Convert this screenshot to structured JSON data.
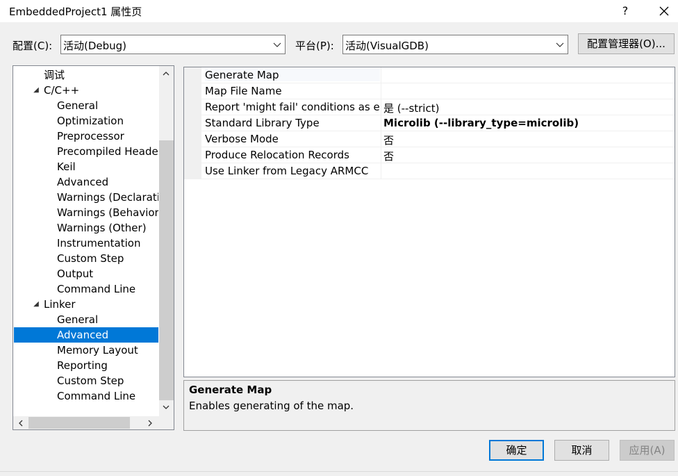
{
  "window": {
    "title": "EmbeddedProject1 属性页",
    "help": "?"
  },
  "config": {
    "label": "配置(C):",
    "value": "活动(Debug)",
    "platform_label": "平台(P):",
    "platform_value": "活动(VisualGDB)",
    "manager_button": "配置管理器(O)..."
  },
  "tree": {
    "items": [
      {
        "label": "调试",
        "level": 1
      },
      {
        "label": "C/C++",
        "level": 0,
        "expanded": true
      },
      {
        "label": "General",
        "level": 2
      },
      {
        "label": "Optimization",
        "level": 2
      },
      {
        "label": "Preprocessor",
        "level": 2
      },
      {
        "label": "Precompiled Heade",
        "level": 2
      },
      {
        "label": "Keil",
        "level": 2
      },
      {
        "label": "Advanced",
        "level": 2
      },
      {
        "label": "Warnings (Declaratio",
        "level": 2
      },
      {
        "label": "Warnings (Behavior)",
        "level": 2
      },
      {
        "label": "Warnings (Other)",
        "level": 2
      },
      {
        "label": "Instrumentation",
        "level": 2
      },
      {
        "label": "Custom Step",
        "level": 2
      },
      {
        "label": "Output",
        "level": 2
      },
      {
        "label": "Command Line",
        "level": 2
      },
      {
        "label": "Linker",
        "level": 0,
        "expanded": true
      },
      {
        "label": "General",
        "level": 2
      },
      {
        "label": "Advanced",
        "level": 2,
        "selected": true
      },
      {
        "label": "Memory Layout",
        "level": 2
      },
      {
        "label": "Reporting",
        "level": 2
      },
      {
        "label": "Custom Step",
        "level": 2
      },
      {
        "label": "Command Line",
        "level": 2
      }
    ]
  },
  "grid": {
    "rows": [
      {
        "name": "Generate Map",
        "value": "",
        "bold": false
      },
      {
        "name": "Map File Name",
        "value": "",
        "bold": false
      },
      {
        "name": "Report 'might fail' conditions as errors",
        "value": "是 (--strict)",
        "bold": false
      },
      {
        "name": "Standard Library Type",
        "value": "Microlib (--library_type=microlib)",
        "bold": true
      },
      {
        "name": "Verbose Mode",
        "value": "否",
        "bold": false
      },
      {
        "name": "Produce Relocation Records",
        "value": "否",
        "bold": false
      },
      {
        "name": "Use Linker from Legacy ARMCC",
        "value": "",
        "bold": false
      }
    ]
  },
  "description": {
    "title": "Generate Map",
    "text": "Enables generating of the map."
  },
  "buttons": {
    "ok": "确定",
    "cancel": "取消",
    "apply": "应用(A)"
  },
  "colors": {
    "selection": "#0078d7",
    "window_bg": "#f0f0f0"
  }
}
